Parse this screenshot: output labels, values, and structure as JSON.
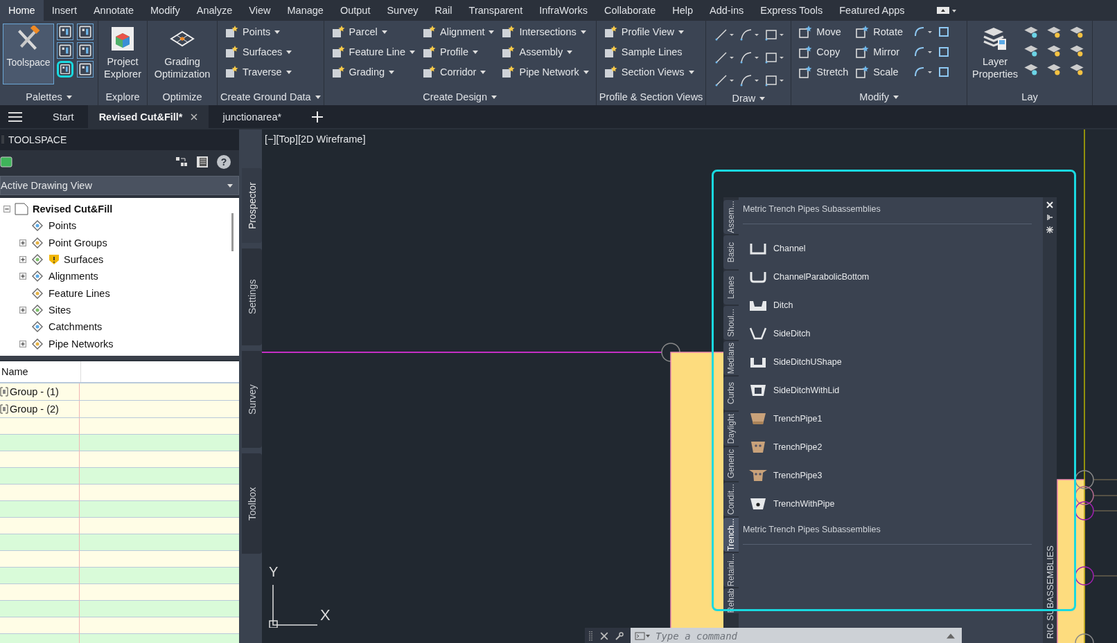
{
  "menu": [
    {
      "label": "Home",
      "selected": true
    },
    {
      "label": "Insert",
      "selected": false
    },
    {
      "label": "Annotate",
      "selected": false
    },
    {
      "label": "Modify",
      "selected": false
    },
    {
      "label": "Analyze",
      "selected": false
    },
    {
      "label": "View",
      "selected": false
    },
    {
      "label": "Manage",
      "selected": false
    },
    {
      "label": "Output",
      "selected": false
    },
    {
      "label": "Survey",
      "selected": false
    },
    {
      "label": "Rail",
      "selected": false
    },
    {
      "label": "Transparent",
      "selected": false
    },
    {
      "label": "InfraWorks",
      "selected": false
    },
    {
      "label": "Collaborate",
      "selected": false
    },
    {
      "label": "Help",
      "selected": false
    },
    {
      "label": "Add-ins",
      "selected": false
    },
    {
      "label": "Express Tools",
      "selected": false
    },
    {
      "label": "Featured Apps",
      "selected": false
    }
  ],
  "ribbon": [
    {
      "kind": "palettes",
      "label": "Palettes",
      "dropdown": true,
      "big": [
        "Toolspace"
      ]
    },
    {
      "kind": "explore",
      "label": "Explore",
      "dropdown": false,
      "big": [
        "Project Explorer"
      ]
    },
    {
      "kind": "optimize",
      "label": "Optimize",
      "dropdown": false,
      "big": [
        "Grading Optimization"
      ]
    },
    {
      "kind": "ground",
      "label": "Create Ground Data",
      "dropdown": true,
      "columns": [
        [
          {
            "label": "Points",
            "dropdown": true
          },
          {
            "label": "Surfaces",
            "dropdown": true
          },
          {
            "label": "Traverse",
            "dropdown": true
          }
        ]
      ]
    },
    {
      "kind": "design",
      "label": "Create Design",
      "dropdown": true,
      "columns": [
        [
          {
            "label": "Parcel",
            "dropdown": true
          },
          {
            "label": "Feature Line",
            "dropdown": true
          },
          {
            "label": "Grading",
            "dropdown": true
          }
        ],
        [
          {
            "label": "Alignment",
            "dropdown": true
          },
          {
            "label": "Profile",
            "dropdown": true
          },
          {
            "label": "Corridor",
            "dropdown": true
          }
        ],
        [
          {
            "label": "Intersections",
            "dropdown": true
          },
          {
            "label": "Assembly",
            "dropdown": true
          },
          {
            "label": "Pipe Network",
            "dropdown": true
          }
        ]
      ]
    },
    {
      "kind": "views",
      "label": "Profile & Section Views",
      "dropdown": false,
      "columns": [
        [
          {
            "label": "Profile View",
            "dropdown": true
          },
          {
            "label": "Sample Lines",
            "dropdown": false
          },
          {
            "label": "Section Views",
            "dropdown": true
          }
        ]
      ]
    },
    {
      "kind": "draw",
      "label": "Draw",
      "dropdown": true
    },
    {
      "kind": "modify",
      "label": "Modify",
      "dropdown": true,
      "columns": [
        [
          {
            "label": "Move",
            "dropdown": false
          },
          {
            "label": "Copy",
            "dropdown": false
          },
          {
            "label": "Stretch",
            "dropdown": false
          }
        ],
        [
          {
            "label": "Rotate",
            "dropdown": false
          },
          {
            "label": "Mirror",
            "dropdown": false
          },
          {
            "label": "Scale",
            "dropdown": false
          }
        ]
      ]
    },
    {
      "kind": "layers",
      "label": "Lay",
      "dropdown": false,
      "big": [
        "Layer Properties"
      ]
    }
  ],
  "doc_tabs": [
    {
      "label": "Start",
      "selected": false
    },
    {
      "label": "Revised Cut&Fill*",
      "selected": true
    },
    {
      "label": "junctionarea*",
      "selected": false
    }
  ],
  "toolspace": {
    "title": "TOOLSPACE",
    "help": "?",
    "view": "Active Drawing View",
    "tree": {
      "label": "Revised Cut&Fill",
      "expanded": true,
      "children": [
        {
          "label": "Points",
          "warning": false
        },
        {
          "label": "Point Groups",
          "expanded": false,
          "warning": false
        },
        {
          "label": "Surfaces",
          "expanded": false,
          "warning": true
        },
        {
          "label": "Alignments",
          "expanded": false,
          "warning": false
        },
        {
          "label": "Feature Lines",
          "warning": false
        },
        {
          "label": "Sites",
          "expanded": false,
          "warning": false
        },
        {
          "label": "Catchments",
          "warning": false
        },
        {
          "label": "Pipe Networks",
          "expanded": false,
          "warning": false
        }
      ]
    },
    "grid": {
      "columns": [
        "Name"
      ],
      "rows": [
        "Group - (1)",
        "Group - (2)"
      ]
    },
    "tabs": [
      {
        "label": "Prospector",
        "selected": true
      },
      {
        "label": "Settings",
        "selected": false
      },
      {
        "label": "Survey",
        "selected": false
      },
      {
        "label": "Toolbox",
        "selected": false
      }
    ]
  },
  "canvas": {
    "viewport_label": "[−][Top][2D Wireframe]",
    "ucs_y": "Y",
    "ucs_x": "X",
    "command": {
      "placeholder": "Type a command"
    }
  },
  "palette": {
    "tabs": [
      {
        "label": "Assem...",
        "selected": false
      },
      {
        "label": "Basic",
        "selected": false
      },
      {
        "label": "Lanes",
        "selected": false
      },
      {
        "label": "Shoul...",
        "selected": false
      },
      {
        "label": "Medians",
        "selected": false
      },
      {
        "label": "Curbs",
        "selected": false
      },
      {
        "label": "Daylight",
        "selected": false
      },
      {
        "label": "Generic",
        "selected": false
      },
      {
        "label": "Condit...",
        "selected": false
      },
      {
        "label": "Trench...",
        "selected": true
      },
      {
        "label": "Retaini...",
        "selected": false
      },
      {
        "label": "Rehab",
        "selected": false
      }
    ],
    "header": "Metric Trench Pipes Subassemblies",
    "items": [
      "Channel",
      "ChannelParabolicBottom",
      "Ditch",
      "SideDitch",
      "SideDitchUShape",
      "SideDitchWithLid",
      "TrenchPipe1",
      "TrenchPipe2",
      "TrenchPipe3",
      "TrenchWithPipe"
    ],
    "footer": "Metric Trench Pipes Subassemblies",
    "side_title": "RIC SUBASSEMBLIES"
  }
}
